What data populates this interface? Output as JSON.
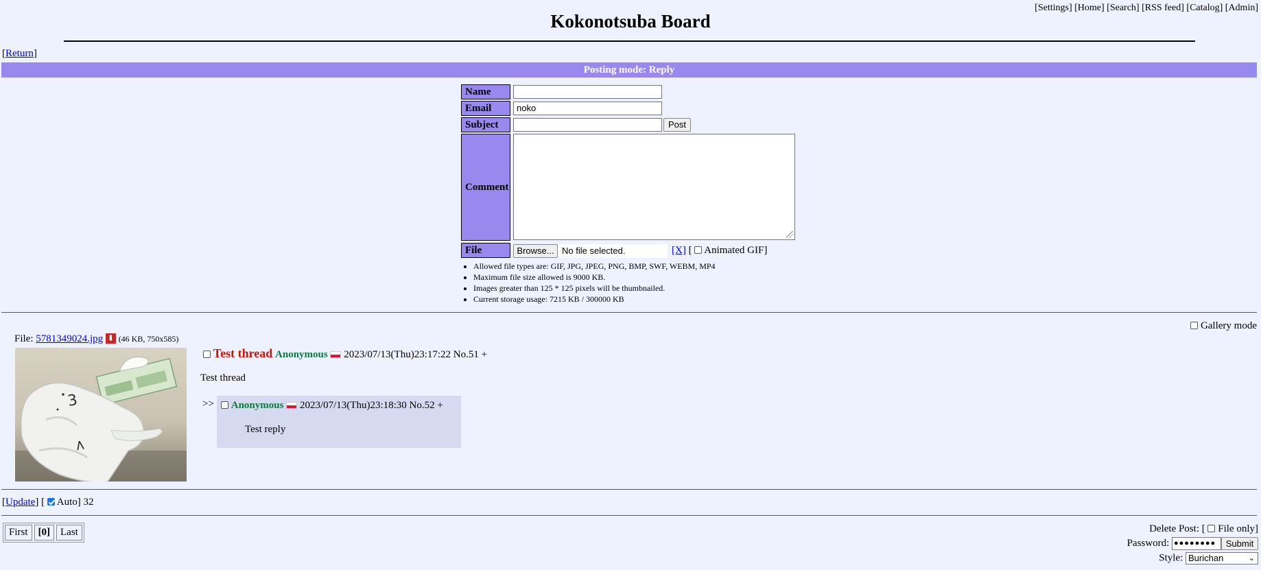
{
  "topnav": {
    "items": [
      "Settings",
      "Home",
      "Search",
      "RSS feed",
      "Catalog",
      "Admin"
    ]
  },
  "board": {
    "title": "Kokonotsuba Board"
  },
  "return_link": "Return",
  "posting_mode": "Posting mode: Reply",
  "form": {
    "name_label": "Name",
    "name_value": "",
    "email_label": "Email",
    "email_value": "noko",
    "subject_label": "Subject",
    "subject_value": "",
    "post_button": "Post",
    "comment_label": "Comment",
    "comment_value": "",
    "file_label": "File",
    "browse_button": "Browse...",
    "file_status": "No file selected.",
    "remove_file": "[X]",
    "animated_gif_label": "Animated GIF",
    "rules": [
      "Allowed file types are: GIF, JPG, JPEG, PNG, BMP, SWF, WEBM, MP4",
      "Maximum file size allowed is 9000 KB.",
      "Images greater than 125 * 125 pixels will be thumbnailed.",
      "Current storage usage: 7215 KB / 300000 KB"
    ]
  },
  "gallery_mode_label": "Gallery mode",
  "thread": {
    "file_prefix": "File:",
    "file_name": "5781349024.jpg",
    "file_meta": "(46 KB, 750x585)",
    "op": {
      "subject": "Test thread",
      "name": "Anonymous",
      "datetime": "2023/07/13(Thu)23:17:22",
      "number": "No.51",
      "plus": "+",
      "body": "Test thread"
    },
    "reply_arrows": ">>",
    "replies": [
      {
        "name": "Anonymous",
        "datetime": "2023/07/13(Thu)23:18:30",
        "number": "No.52",
        "plus": "+",
        "body": "Test reply"
      }
    ]
  },
  "update": {
    "link": "Update",
    "auto_label": "Auto",
    "auto_checked": true,
    "countdown": "32"
  },
  "pager": {
    "first": "First",
    "current": "[0]",
    "last": "Last"
  },
  "delete": {
    "label": "Delete Post:",
    "file_only_label": "File only",
    "password_label": "Password:",
    "password_mask": "●●●●●●●●",
    "submit_button": "Submit"
  },
  "style": {
    "label": "Style:",
    "selected": "Burichan"
  },
  "colors": {
    "background": "#eef2ff",
    "header_bar": "#9988ee",
    "subject": "#cc1105",
    "poster_name": "#117743",
    "reply_bg": "#d6daf0"
  }
}
